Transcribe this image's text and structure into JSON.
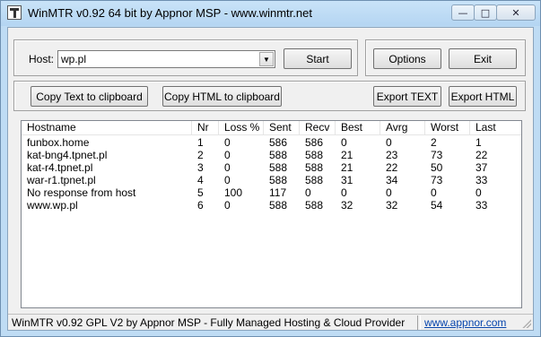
{
  "window": {
    "title": "WinMTR v0.92 64 bit by Appnor MSP - www.winmtr.net",
    "minimize_glyph": "—",
    "maximize_glyph": "□",
    "close_glyph": "✕"
  },
  "host": {
    "label": "Host:",
    "value": "wp.pl",
    "dropdown_glyph": "▼"
  },
  "buttons": {
    "start": "Start",
    "options": "Options",
    "exit": "Exit",
    "copy_text": "Copy Text to clipboard",
    "copy_html": "Copy HTML to clipboard",
    "export_text": "Export TEXT",
    "export_html": "Export HTML"
  },
  "table": {
    "columns": [
      "Hostname",
      "Nr",
      "Loss %",
      "Sent",
      "Recv",
      "Best",
      "Avrg",
      "Worst",
      "Last"
    ],
    "rows": [
      [
        "funbox.home",
        "1",
        "0",
        "586",
        "586",
        "0",
        "0",
        "2",
        "1"
      ],
      [
        "kat-bng4.tpnet.pl",
        "2",
        "0",
        "588",
        "588",
        "21",
        "23",
        "73",
        "22"
      ],
      [
        "kat-r4.tpnet.pl",
        "3",
        "0",
        "588",
        "588",
        "21",
        "22",
        "50",
        "37"
      ],
      [
        "war-r1.tpnet.pl",
        "4",
        "0",
        "588",
        "588",
        "31",
        "34",
        "73",
        "33"
      ],
      [
        "No response from host",
        "5",
        "100",
        "117",
        "0",
        "0",
        "0",
        "0",
        "0"
      ],
      [
        "www.wp.pl",
        "6",
        "0",
        "588",
        "588",
        "32",
        "32",
        "54",
        "33"
      ]
    ]
  },
  "status": {
    "text": "WinMTR v0.92 GPL V2 by Appnor MSP - Fully Managed Hosting & Cloud Provider",
    "link": "www.appnor.com"
  }
}
